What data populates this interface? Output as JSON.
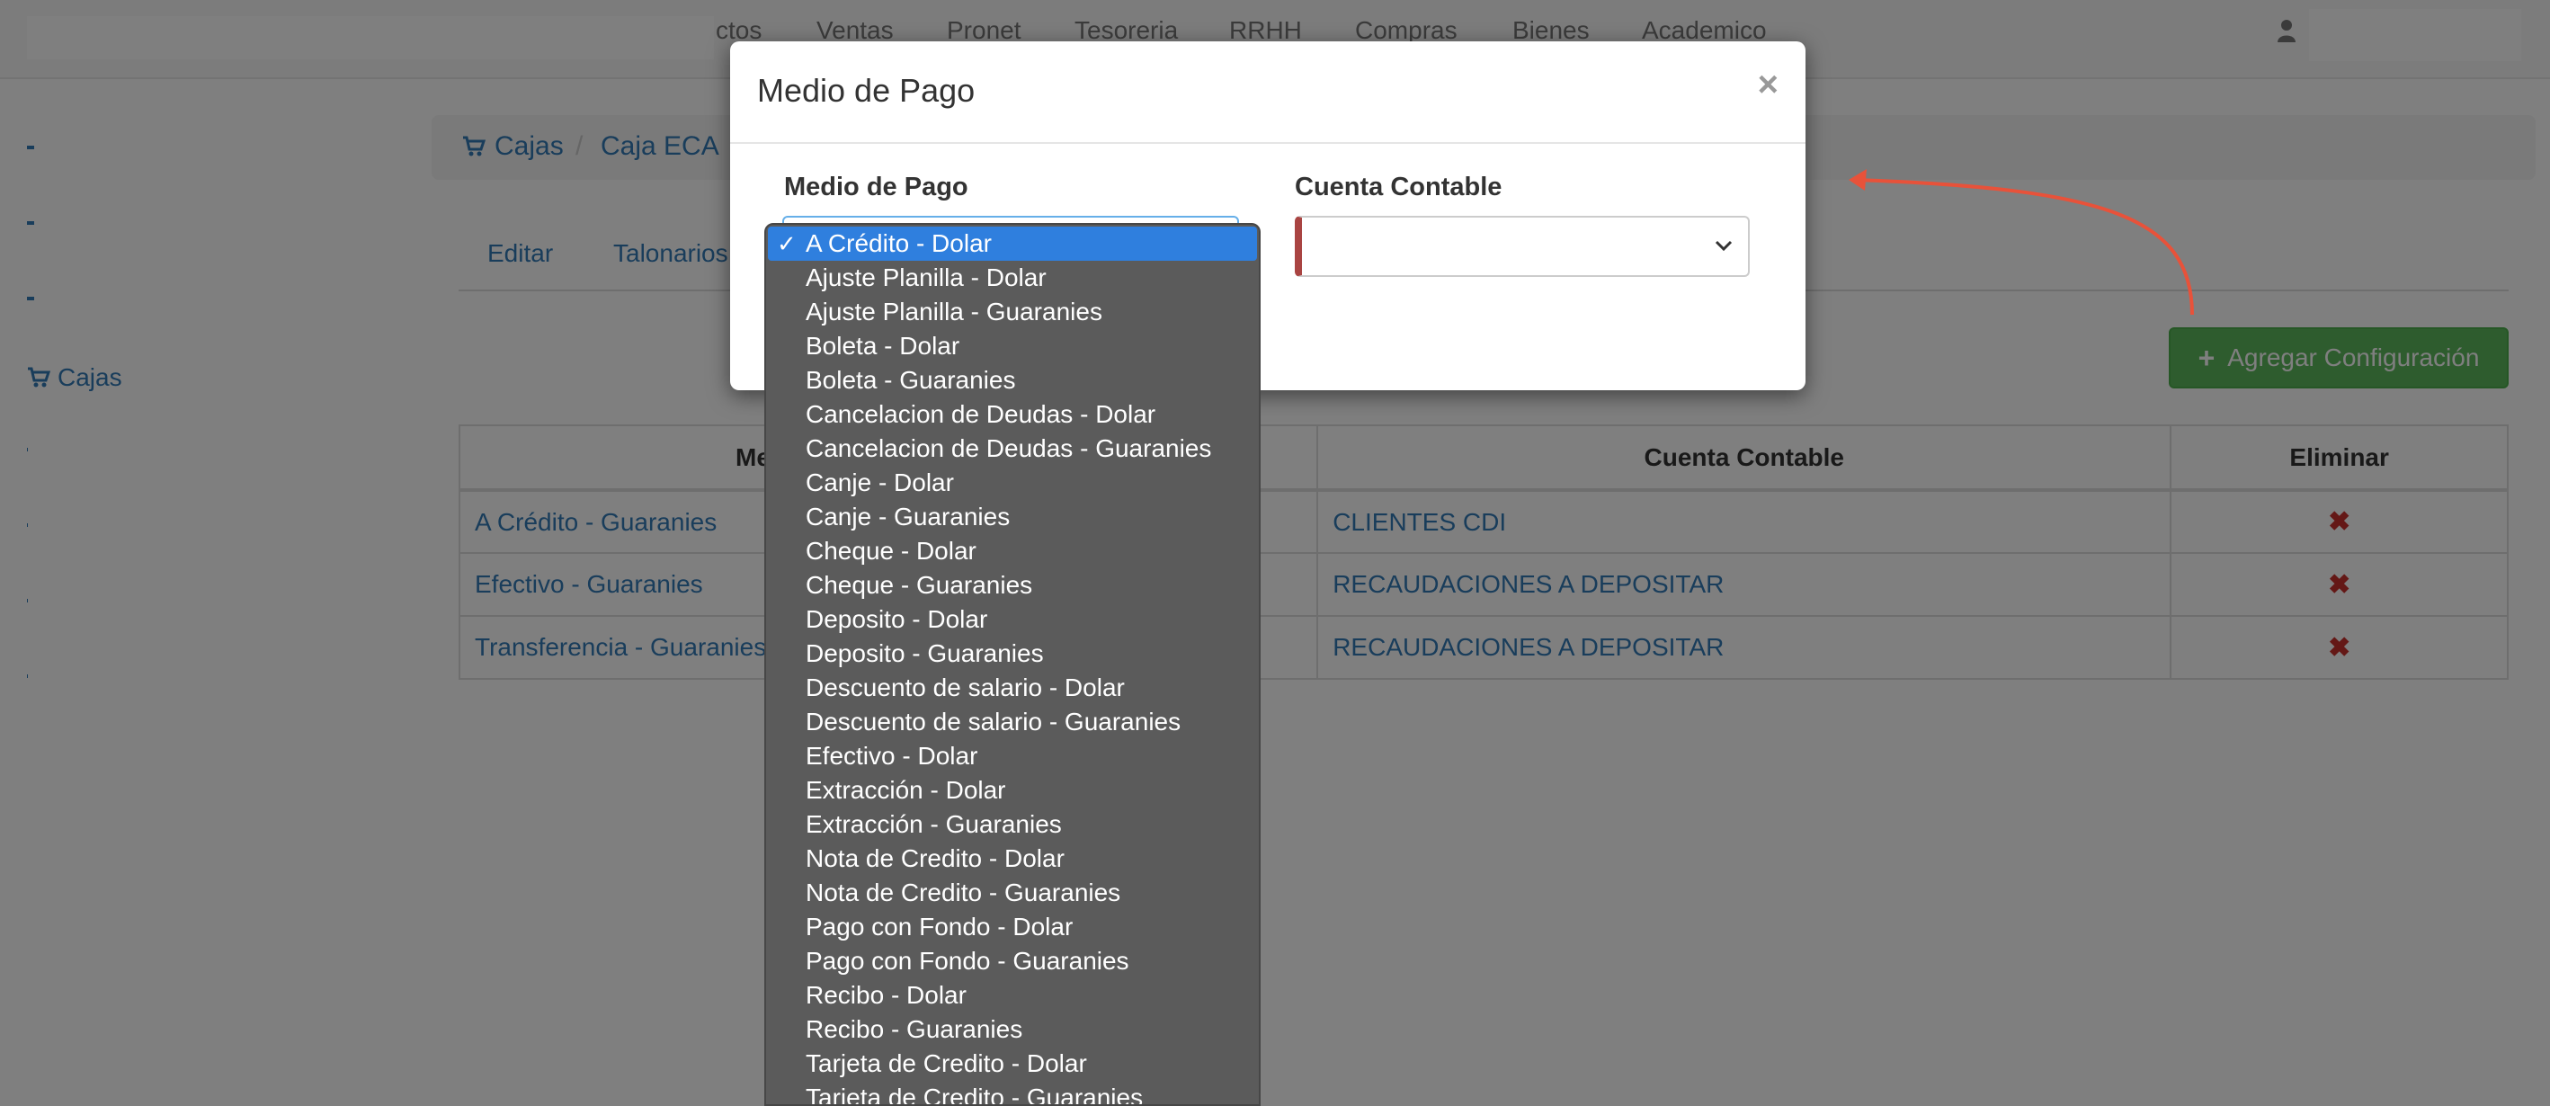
{
  "navbar": {
    "items": [
      "ctos",
      "Ventas",
      "Pronet",
      "Tesoreria",
      "RRHH",
      "Compras",
      "Bienes",
      "Academico"
    ]
  },
  "sidebar": {
    "cajas_label": "Cajas"
  },
  "breadcrumb": {
    "items": [
      "Cajas",
      "Caja ECA"
    ],
    "separator": "/"
  },
  "tabs": [
    "Editar",
    "Talonarios"
  ],
  "actions": {
    "add_label": "Agregar Configuración"
  },
  "table": {
    "headers": [
      "Me",
      "Cuenta Contable",
      "Eliminar"
    ],
    "rows": [
      {
        "medio": "A Crédito - Guaranies",
        "cuenta": "CLIENTES CDI"
      },
      {
        "medio": "Efectivo - Guaranies",
        "cuenta": "RECAUDACIONES A DEPOSITAR"
      },
      {
        "medio": "Transferencia - Guaranies",
        "cuenta": "RECAUDACIONES A DEPOSITAR"
      }
    ],
    "delete_glyph": "✖"
  },
  "modal": {
    "title": "Medio de Pago",
    "close": "×",
    "medio_label": "Medio de Pago",
    "cuenta_label": "Cuenta Contable",
    "cuenta_value": ""
  },
  "dropdown": {
    "check": "✓",
    "selected_index": 0,
    "options": [
      "A Crédito - Dolar",
      "Ajuste Planilla - Dolar",
      "Ajuste Planilla - Guaranies",
      "Boleta - Dolar",
      "Boleta - Guaranies",
      "Cancelacion de Deudas - Dolar",
      "Cancelacion de Deudas - Guaranies",
      "Canje - Dolar",
      "Canje - Guaranies",
      "Cheque - Dolar",
      "Cheque - Guaranies",
      "Deposito - Dolar",
      "Deposito - Guaranies",
      "Descuento de salario - Dolar",
      "Descuento de salario - Guaranies",
      "Efectivo - Dolar",
      "Extracción - Dolar",
      "Extracción - Guaranies",
      "Nota de Credito - Dolar",
      "Nota de Credito - Guaranies",
      "Pago con Fondo - Dolar",
      "Pago con Fondo - Guaranies",
      "Recibo - Dolar",
      "Recibo - Guaranies",
      "Tarjeta de Credito - Dolar",
      "Tarjeta de Credito - Guaranies"
    ]
  },
  "colors": {
    "link": "#337ab7",
    "success": "#5cb85c",
    "danger": "#c9302c",
    "selected_option": "#2f7fde",
    "annotation_arrow": "#e8523a"
  }
}
